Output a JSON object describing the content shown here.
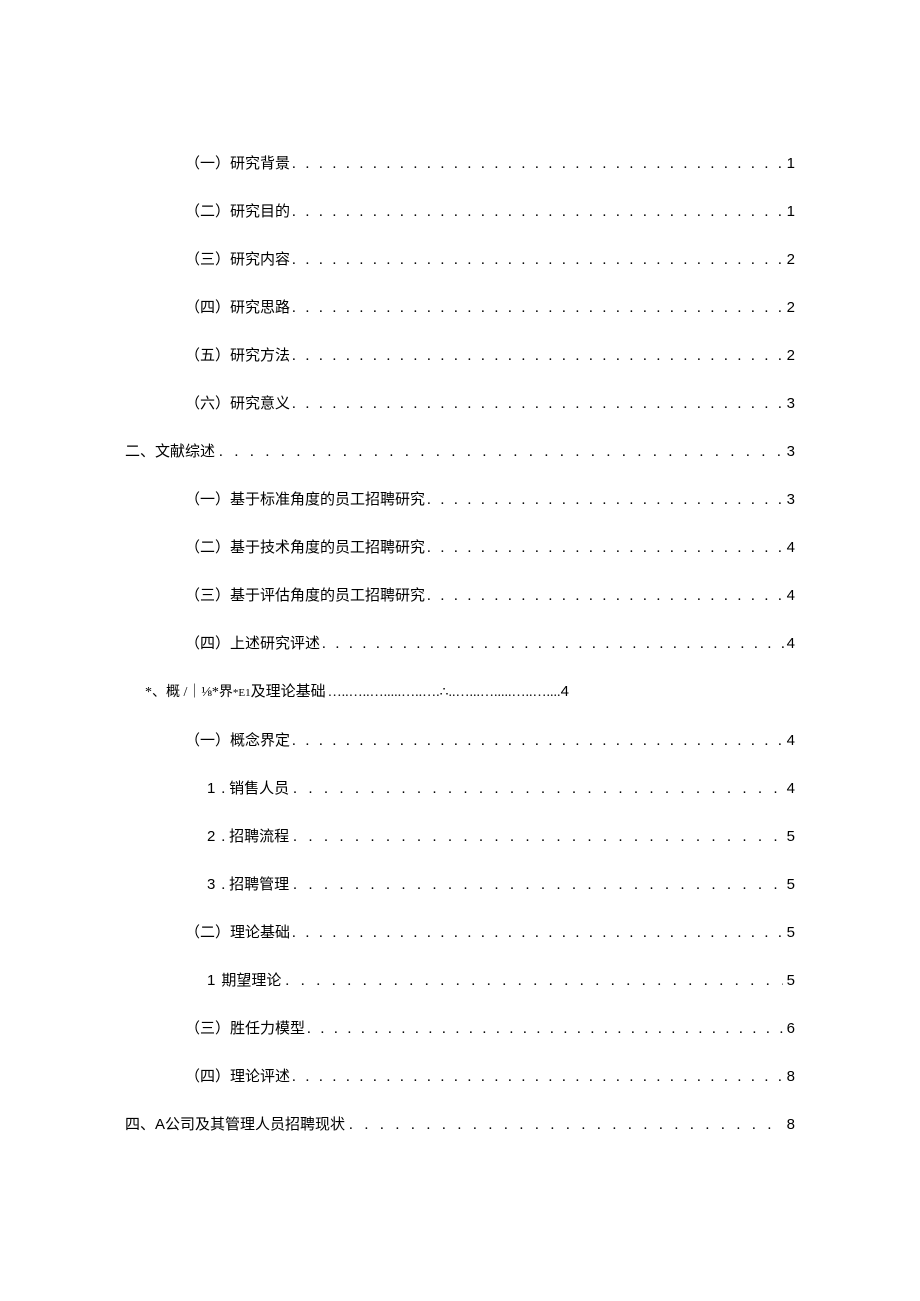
{
  "toc": [
    {
      "indent": 2,
      "label": "（一）研究背景",
      "leader": "dot",
      "page": "1"
    },
    {
      "indent": 2,
      "label": "（二）研究目的",
      "leader": "dot",
      "page": "1"
    },
    {
      "indent": 2,
      "label": "（三）研究内容",
      "leader": "dot",
      "page": "2"
    },
    {
      "indent": 2,
      "label": "（四）研究思路",
      "leader": "dot",
      "page": "2"
    },
    {
      "indent": 2,
      "label": "（五）研究方法",
      "leader": "dot",
      "page": "2"
    },
    {
      "indent": 2,
      "label": "（六）研究意义",
      "leader": "dot",
      "page": "3"
    },
    {
      "indent": 1,
      "label": "二、文献综述",
      "leader": "wide",
      "page": "3"
    },
    {
      "indent": 2,
      "label": "（一）基于标准角度的员工招聘研究",
      "leader": "dot",
      "page": "3"
    },
    {
      "indent": 2,
      "label": "（二）基于技术角度的员工招聘研究",
      "leader": "dot",
      "page": "4"
    },
    {
      "indent": 2,
      "label": "（三）基于评估角度的员工招聘研究",
      "leader": "dot",
      "page": "4"
    },
    {
      "indent": 2,
      "label": "（四）上述研究评述",
      "leader": "dot",
      "page": "4"
    },
    {
      "indent": 1,
      "label_special": true
    },
    {
      "indent": 2,
      "label": "（一）概念界定",
      "leader": "dot",
      "page": "4"
    },
    {
      "indent": 3,
      "num": "1",
      "sep": ".",
      "label": "销售人员",
      "leader": "wide",
      "page": "4"
    },
    {
      "indent": 3,
      "num": "2",
      "sep": ".",
      "label": "招聘流程",
      "leader": "wide",
      "page": "5"
    },
    {
      "indent": 3,
      "num": "3",
      "sep": ".",
      "label": "招聘管理",
      "leader": "wide",
      "page": "5"
    },
    {
      "indent": 2,
      "label": "（二）理论基础",
      "leader": "dot",
      "page": "5"
    },
    {
      "indent": 3,
      "num": "1",
      "sep": "",
      "label": "期望理论",
      "leader": "wide",
      "page": "5"
    },
    {
      "indent": 2,
      "label": "（三）胜任力模型",
      "leader": "dot",
      "page": "6"
    },
    {
      "indent": 2,
      "label": "（四）理论评述",
      "leader": "dot",
      "page": "8"
    },
    {
      "indent": 1,
      "label_mixed": true,
      "prefix": "四、",
      "latin": "A",
      "suffix": " 公司及其管理人员招聘现状",
      "leader": "wide",
      "page": "8"
    }
  ],
  "special_row": {
    "text_before": "*、概 /｜⅛*界",
    "text_mid": "*E1",
    "text_after": " 及理论基础",
    "wave": "…..…..….....…..….∴..…...….....…..…....",
    "page": "4"
  }
}
